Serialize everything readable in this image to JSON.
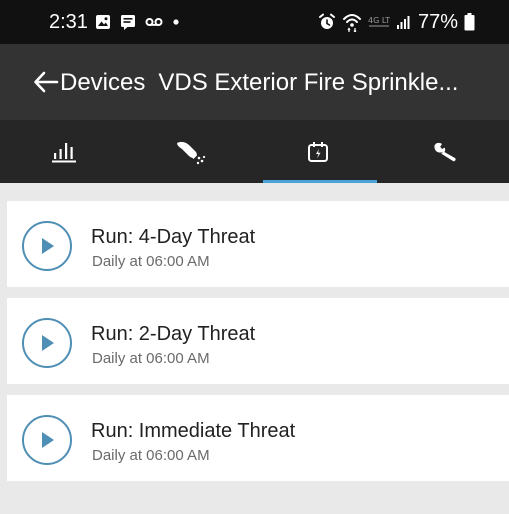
{
  "status_bar": {
    "time": "2:31",
    "battery_percent": "77%",
    "left_icons": [
      "image-icon",
      "message-icon",
      "voicemail-icon",
      "dot-icon"
    ],
    "right_icons": [
      "alarm-icon",
      "wifi-icon",
      "lte-icon",
      "signal-icon",
      "battery-icon"
    ],
    "lte_label": "4G LTE"
  },
  "app_bar": {
    "back_label": "Devices",
    "device_name": "VDS Exterior Fire Sprinkle..."
  },
  "tabs": [
    {
      "icon": "bar-chart-icon",
      "active": false
    },
    {
      "icon": "sprinkler-icon",
      "active": false
    },
    {
      "icon": "schedule-icon",
      "active": true
    },
    {
      "icon": "wrench-icon",
      "active": false
    }
  ],
  "colors": {
    "accent": "#4aa3d8",
    "play_ring": "#4f8fb5",
    "status_bar_bg": "#111111",
    "app_bar_bg": "#333333",
    "tab_bar_bg": "#262626",
    "list_bg": "#e9e9e9"
  },
  "schedules": [
    {
      "title": "Run: 4-Day Threat",
      "subtitle": "Daily at 06:00 AM"
    },
    {
      "title": "Run: 2-Day Threat",
      "subtitle": "Daily at 06:00 AM"
    },
    {
      "title": "Run: Immediate Threat",
      "subtitle": "Daily at 06:00 AM"
    }
  ]
}
